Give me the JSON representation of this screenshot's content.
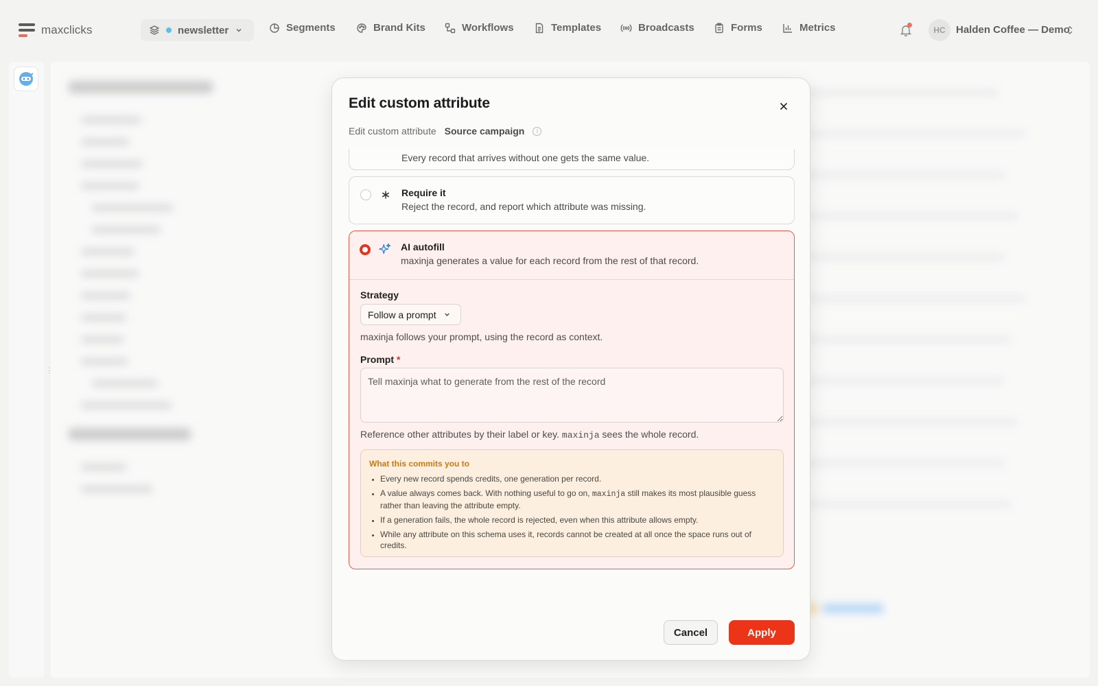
{
  "app": {
    "name": "maxclicks"
  },
  "nav": {
    "space": "newsletter",
    "items": [
      {
        "label": "Segments",
        "icon": "segments-icon"
      },
      {
        "label": "Brand Kits",
        "icon": "palette-icon"
      },
      {
        "label": "Workflows",
        "icon": "workflow-icon"
      },
      {
        "label": "Templates",
        "icon": "document-icon"
      },
      {
        "label": "Broadcasts",
        "icon": "broadcast-icon"
      },
      {
        "label": "Forms",
        "icon": "clipboard-icon"
      },
      {
        "label": "Metrics",
        "icon": "bar-chart-icon"
      }
    ],
    "notification_badge": true,
    "account": {
      "initials": "HC",
      "name": "Halden Coffee — Demo"
    }
  },
  "modal": {
    "title": "Edit custom attribute",
    "breadcrumb": {
      "first": "Edit custom attribute",
      "current": "Source campaign"
    },
    "options": {
      "partial_desc": "Every record that arrives without one gets the same value.",
      "require": {
        "title": "Require it",
        "desc": "Reject the record, and report which attribute was missing.",
        "selected": false
      },
      "ai": {
        "title": "AI autofill",
        "desc": "maxinja generates a value for each record from the rest of that record.",
        "selected": true
      }
    },
    "strategy": {
      "label": "Strategy",
      "value": "Follow a prompt",
      "help": "maxinja follows your prompt, using the record as context."
    },
    "prompt": {
      "label": "Prompt",
      "required_mark": "*",
      "placeholder": "Tell maxinja what to generate from the rest of the record",
      "value": "",
      "help_before": "Reference other attributes by their label or key.",
      "help_code": "maxinja",
      "help_after": "sees the whole record."
    },
    "commitments": {
      "title": "What this commits you to",
      "item1": "Every new record spends credits, one generation per record.",
      "item2_before": "A value always comes back. With nothing useful to go on,",
      "item2_code": "maxinja",
      "item2_after": "still makes its most plausible guess rather than leaving the attribute empty.",
      "item3": "If a generation fails, the whole record is rejected, even when this attribute allows empty.",
      "item4": "While any attribute on this schema uses it, records cannot be created at all once the space runs out of credits."
    },
    "buttons": {
      "cancel": "Cancel",
      "apply": "Apply"
    }
  },
  "colors": {
    "accent": "#ec3418",
    "space_dot": "#22a7d6",
    "selected_border": "#ee5a48",
    "warning_title": "#cc7a10"
  }
}
